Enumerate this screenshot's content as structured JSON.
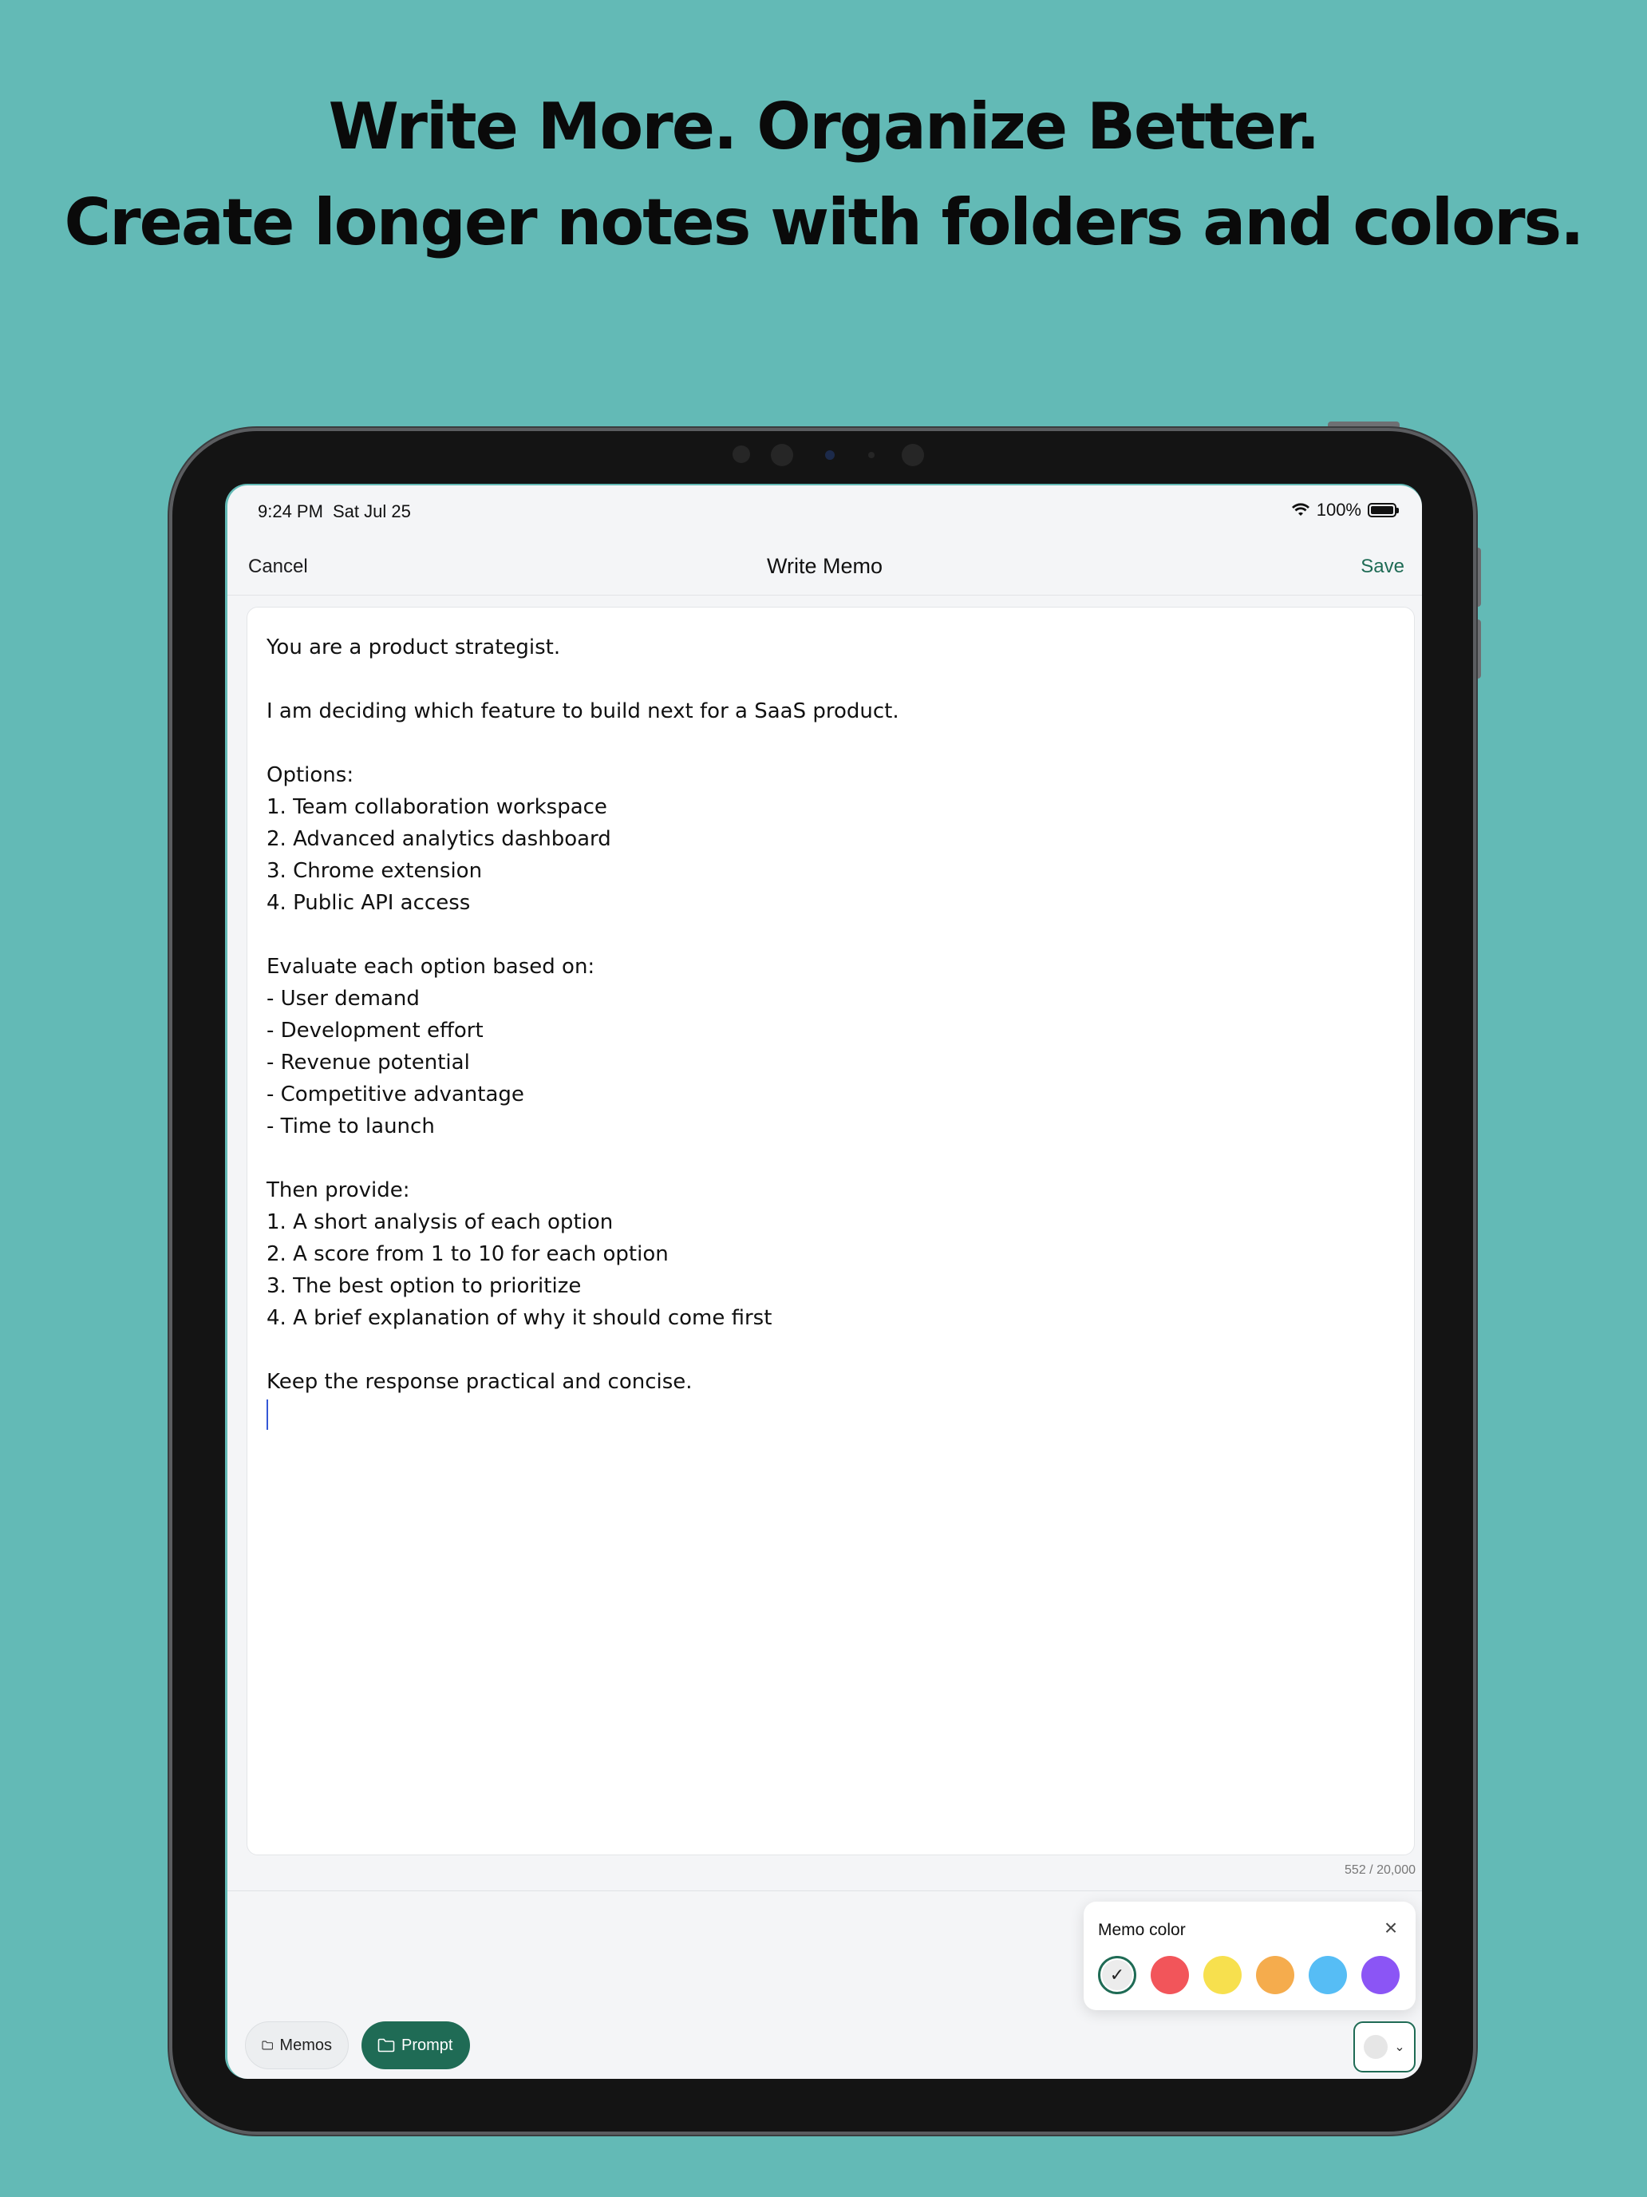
{
  "headline": {
    "line1": "Write More. Organize Better.",
    "line2": "Create longer notes with folders and colors."
  },
  "status_bar": {
    "time": "9:24 PM",
    "date": "Sat Jul 25",
    "battery": "100%"
  },
  "navbar": {
    "cancel": "Cancel",
    "title": "Write Memo",
    "save": "Save"
  },
  "memo": {
    "text": "You are a product strategist.\n\nI am deciding which feature to build next for a SaaS product.\n\nOptions:\n1. Team collaboration workspace\n2. Advanced analytics dashboard\n3. Chrome extension\n4. Public API access\n\nEvaluate each option based on:\n- User demand\n- Development effort\n- Revenue potential\n- Competitive advantage\n- Time to launch\n\nThen provide:\n1. A short analysis of each option\n2. A score from 1 to 10 for each option\n3. The best option to prioritize\n4. A brief explanation of why it should come first\n\nKeep the response practical and concise.",
    "char_count": "552 / 20,000"
  },
  "color_popover": {
    "title": "Memo color",
    "close_icon": "close-icon",
    "swatches": [
      {
        "name": "default",
        "color": "#ececec",
        "selected": true
      },
      {
        "name": "red",
        "color": "#f2555a",
        "selected": false
      },
      {
        "name": "yellow",
        "color": "#f7e04e",
        "selected": false
      },
      {
        "name": "orange",
        "color": "#f5ac4d",
        "selected": false
      },
      {
        "name": "blue",
        "color": "#56bdf5",
        "selected": false
      },
      {
        "name": "purple",
        "color": "#8b55f5",
        "selected": false
      }
    ]
  },
  "folders": [
    {
      "label": "Memos",
      "active": false
    },
    {
      "label": "Prompt",
      "active": true
    }
  ],
  "colors": {
    "background": "#63bab6",
    "accent": "#1f6b55"
  }
}
